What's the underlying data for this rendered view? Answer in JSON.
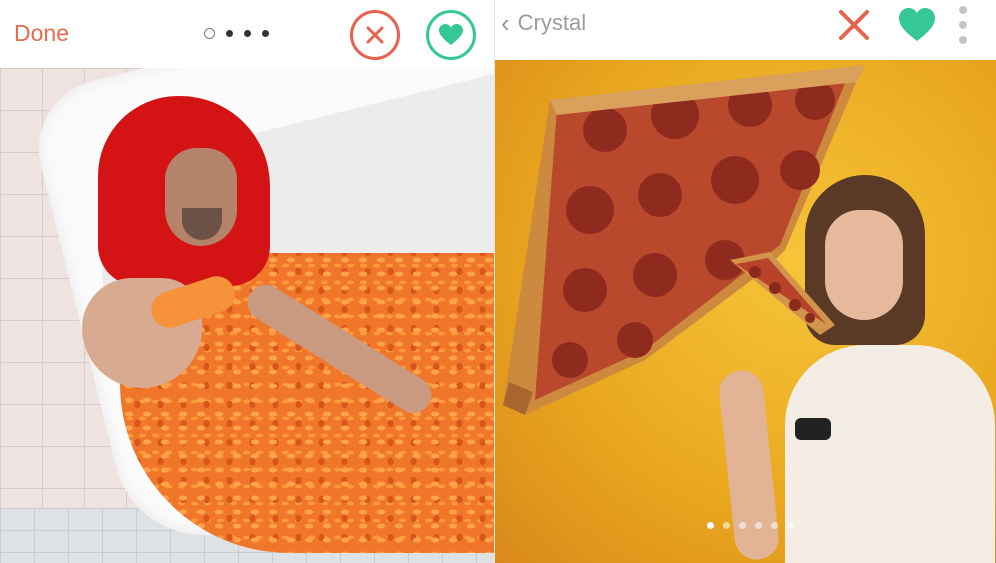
{
  "left_panel": {
    "done_label": "Done",
    "pager": {
      "count": 4,
      "active_index": 0
    },
    "nope_button": {
      "icon": "close-icon",
      "color": "#e8624e"
    },
    "like_button": {
      "icon": "heart-icon",
      "color": "#36c894"
    },
    "photo": {
      "subject": "man-in-bathtub-of-cheese-puffs"
    }
  },
  "right_panel": {
    "back_icon": "chevron-left-icon",
    "profile_name": "Crystal",
    "nope_icon": {
      "icon": "close-icon",
      "color": "#e8624e"
    },
    "like_icon": {
      "icon": "heart-icon",
      "color": "#36c894"
    },
    "menu_icon": "more-vertical-icon",
    "photo": {
      "subject": "woman-holding-pizza-slice"
    },
    "photo_indicator": {
      "count": 6,
      "active_index": 0
    }
  },
  "colors": {
    "accent_red": "#ea6a4e",
    "accent_green": "#36c894",
    "muted_gray": "#9c9c9c"
  }
}
